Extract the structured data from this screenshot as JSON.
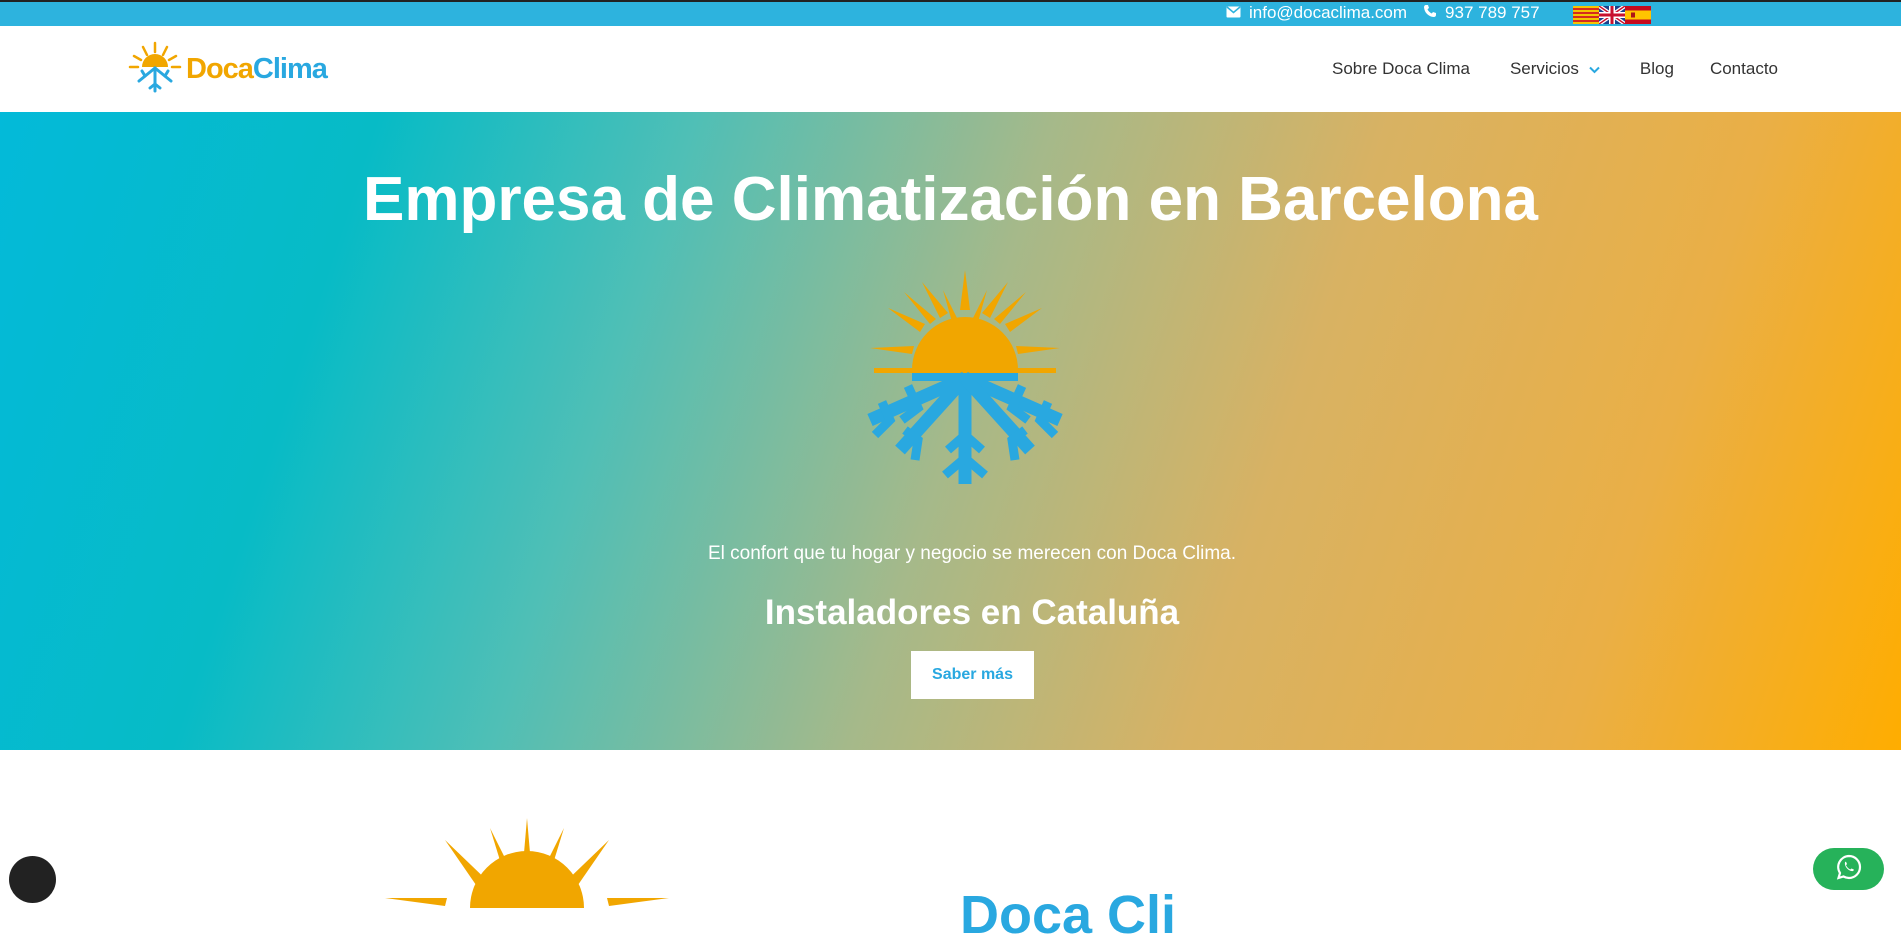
{
  "topbar": {
    "email": "info@docaclima.com",
    "phone": "937 789 757",
    "icons": {
      "email": "envelope-icon",
      "phone": "phone-icon"
    },
    "languages": [
      {
        "code": "ca",
        "icon": "catalan-flag-icon"
      },
      {
        "code": "en",
        "icon": "uk-flag-icon"
      },
      {
        "code": "es",
        "icon": "spain-flag-icon"
      }
    ],
    "color": "#2db3de"
  },
  "brand": {
    "name_part1": "Doca",
    "name_part2": "Clima",
    "colors": {
      "orange": "#f1a600",
      "blue": "#29a8e0"
    }
  },
  "nav": {
    "items": [
      {
        "label": "Sobre Doca Clima"
      },
      {
        "label": "Servicios",
        "has_dropdown": true
      },
      {
        "label": "Blog"
      },
      {
        "label": "Contacto"
      }
    ]
  },
  "hero": {
    "title": "Empresa de Climatización en Barcelona",
    "subtitle": "El confort que tu hogar y negocio se merecen con Doca Clima.",
    "heading": "Instaladores en Cataluña",
    "button_label": "Saber más",
    "gradient_colors": [
      "#03bad9",
      "#4fbfb6",
      "#d8b263",
      "#ffad00"
    ]
  },
  "section2": {
    "heading": "Doca Cli"
  },
  "widgets": {
    "whatsapp_color": "#26b25a",
    "whatsapp_icon": "whatsapp-icon",
    "chat_icon": "chat-circle-icon"
  }
}
